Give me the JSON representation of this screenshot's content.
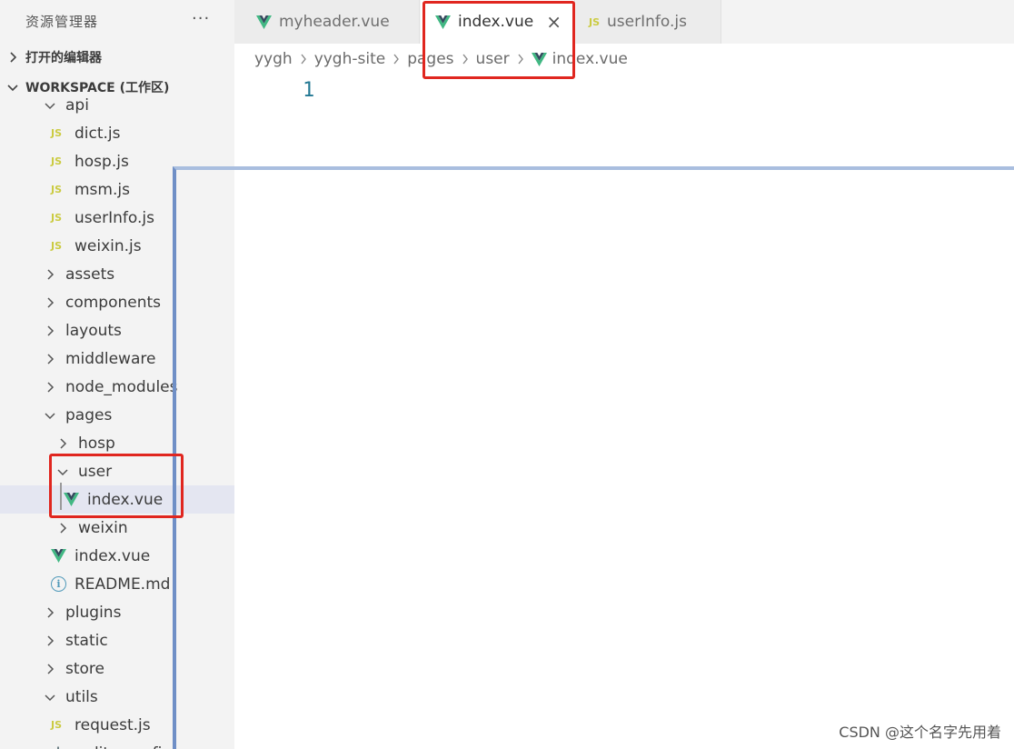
{
  "sidebar": {
    "title": "资源管理器",
    "more": "···",
    "open_editors": "打开的编辑器",
    "workspace": "WORKSPACE (工作区)",
    "items": [
      {
        "label": "api",
        "type": "folder",
        "open": true,
        "depth": 0
      },
      {
        "label": "dict.js",
        "type": "js",
        "depth": 1
      },
      {
        "label": "hosp.js",
        "type": "js",
        "depth": 1
      },
      {
        "label": "msm.js",
        "type": "js",
        "depth": 1
      },
      {
        "label": "userInfo.js",
        "type": "js",
        "depth": 1
      },
      {
        "label": "weixin.js",
        "type": "js",
        "depth": 1
      },
      {
        "label": "assets",
        "type": "folder",
        "open": false,
        "depth": 0
      },
      {
        "label": "components",
        "type": "folder",
        "open": false,
        "depth": 0
      },
      {
        "label": "layouts",
        "type": "folder",
        "open": false,
        "depth": 0
      },
      {
        "label": "middleware",
        "type": "folder",
        "open": false,
        "depth": 0
      },
      {
        "label": "node_modules",
        "type": "folder",
        "open": false,
        "depth": 0
      },
      {
        "label": "pages",
        "type": "folder",
        "open": true,
        "depth": 0
      },
      {
        "label": "hosp",
        "type": "folder",
        "open": false,
        "depth": 1
      },
      {
        "label": "user",
        "type": "folder",
        "open": true,
        "depth": 1
      },
      {
        "label": "index.vue",
        "type": "vue",
        "depth": 2,
        "selected": true
      },
      {
        "label": "weixin",
        "type": "folder",
        "open": false,
        "depth": 1
      },
      {
        "label": "index.vue",
        "type": "vue",
        "depth": 1
      },
      {
        "label": "README.md",
        "type": "info",
        "depth": 1
      },
      {
        "label": "plugins",
        "type": "folder",
        "open": false,
        "depth": 0
      },
      {
        "label": "static",
        "type": "folder",
        "open": false,
        "depth": 0
      },
      {
        "label": "store",
        "type": "folder",
        "open": false,
        "depth": 0
      },
      {
        "label": "utils",
        "type": "folder",
        "open": true,
        "depth": 0
      },
      {
        "label": "request.js",
        "type": "js",
        "depth": 1
      },
      {
        "label": ".editorconfig",
        "type": "gear",
        "depth": 1
      }
    ]
  },
  "tabs": [
    {
      "label": "myheader.vue",
      "type": "vue",
      "active": false
    },
    {
      "label": "index.vue",
      "type": "vue",
      "active": true,
      "close": "×"
    },
    {
      "label": "userInfo.js",
      "type": "js",
      "active": false
    }
  ],
  "breadcrumb": [
    "yygh",
    "yygh-site",
    "pages",
    "user",
    "index.vue"
  ],
  "editor": {
    "line_number": "1"
  },
  "icons": {
    "js_label": "JS",
    "info_glyph": "i"
  },
  "colors": {
    "vue": "#41b883",
    "js": "#cbcb41",
    "info": "#519aba",
    "annotation": "#e0261f"
  },
  "watermark": "CSDN @这个名字先用着"
}
